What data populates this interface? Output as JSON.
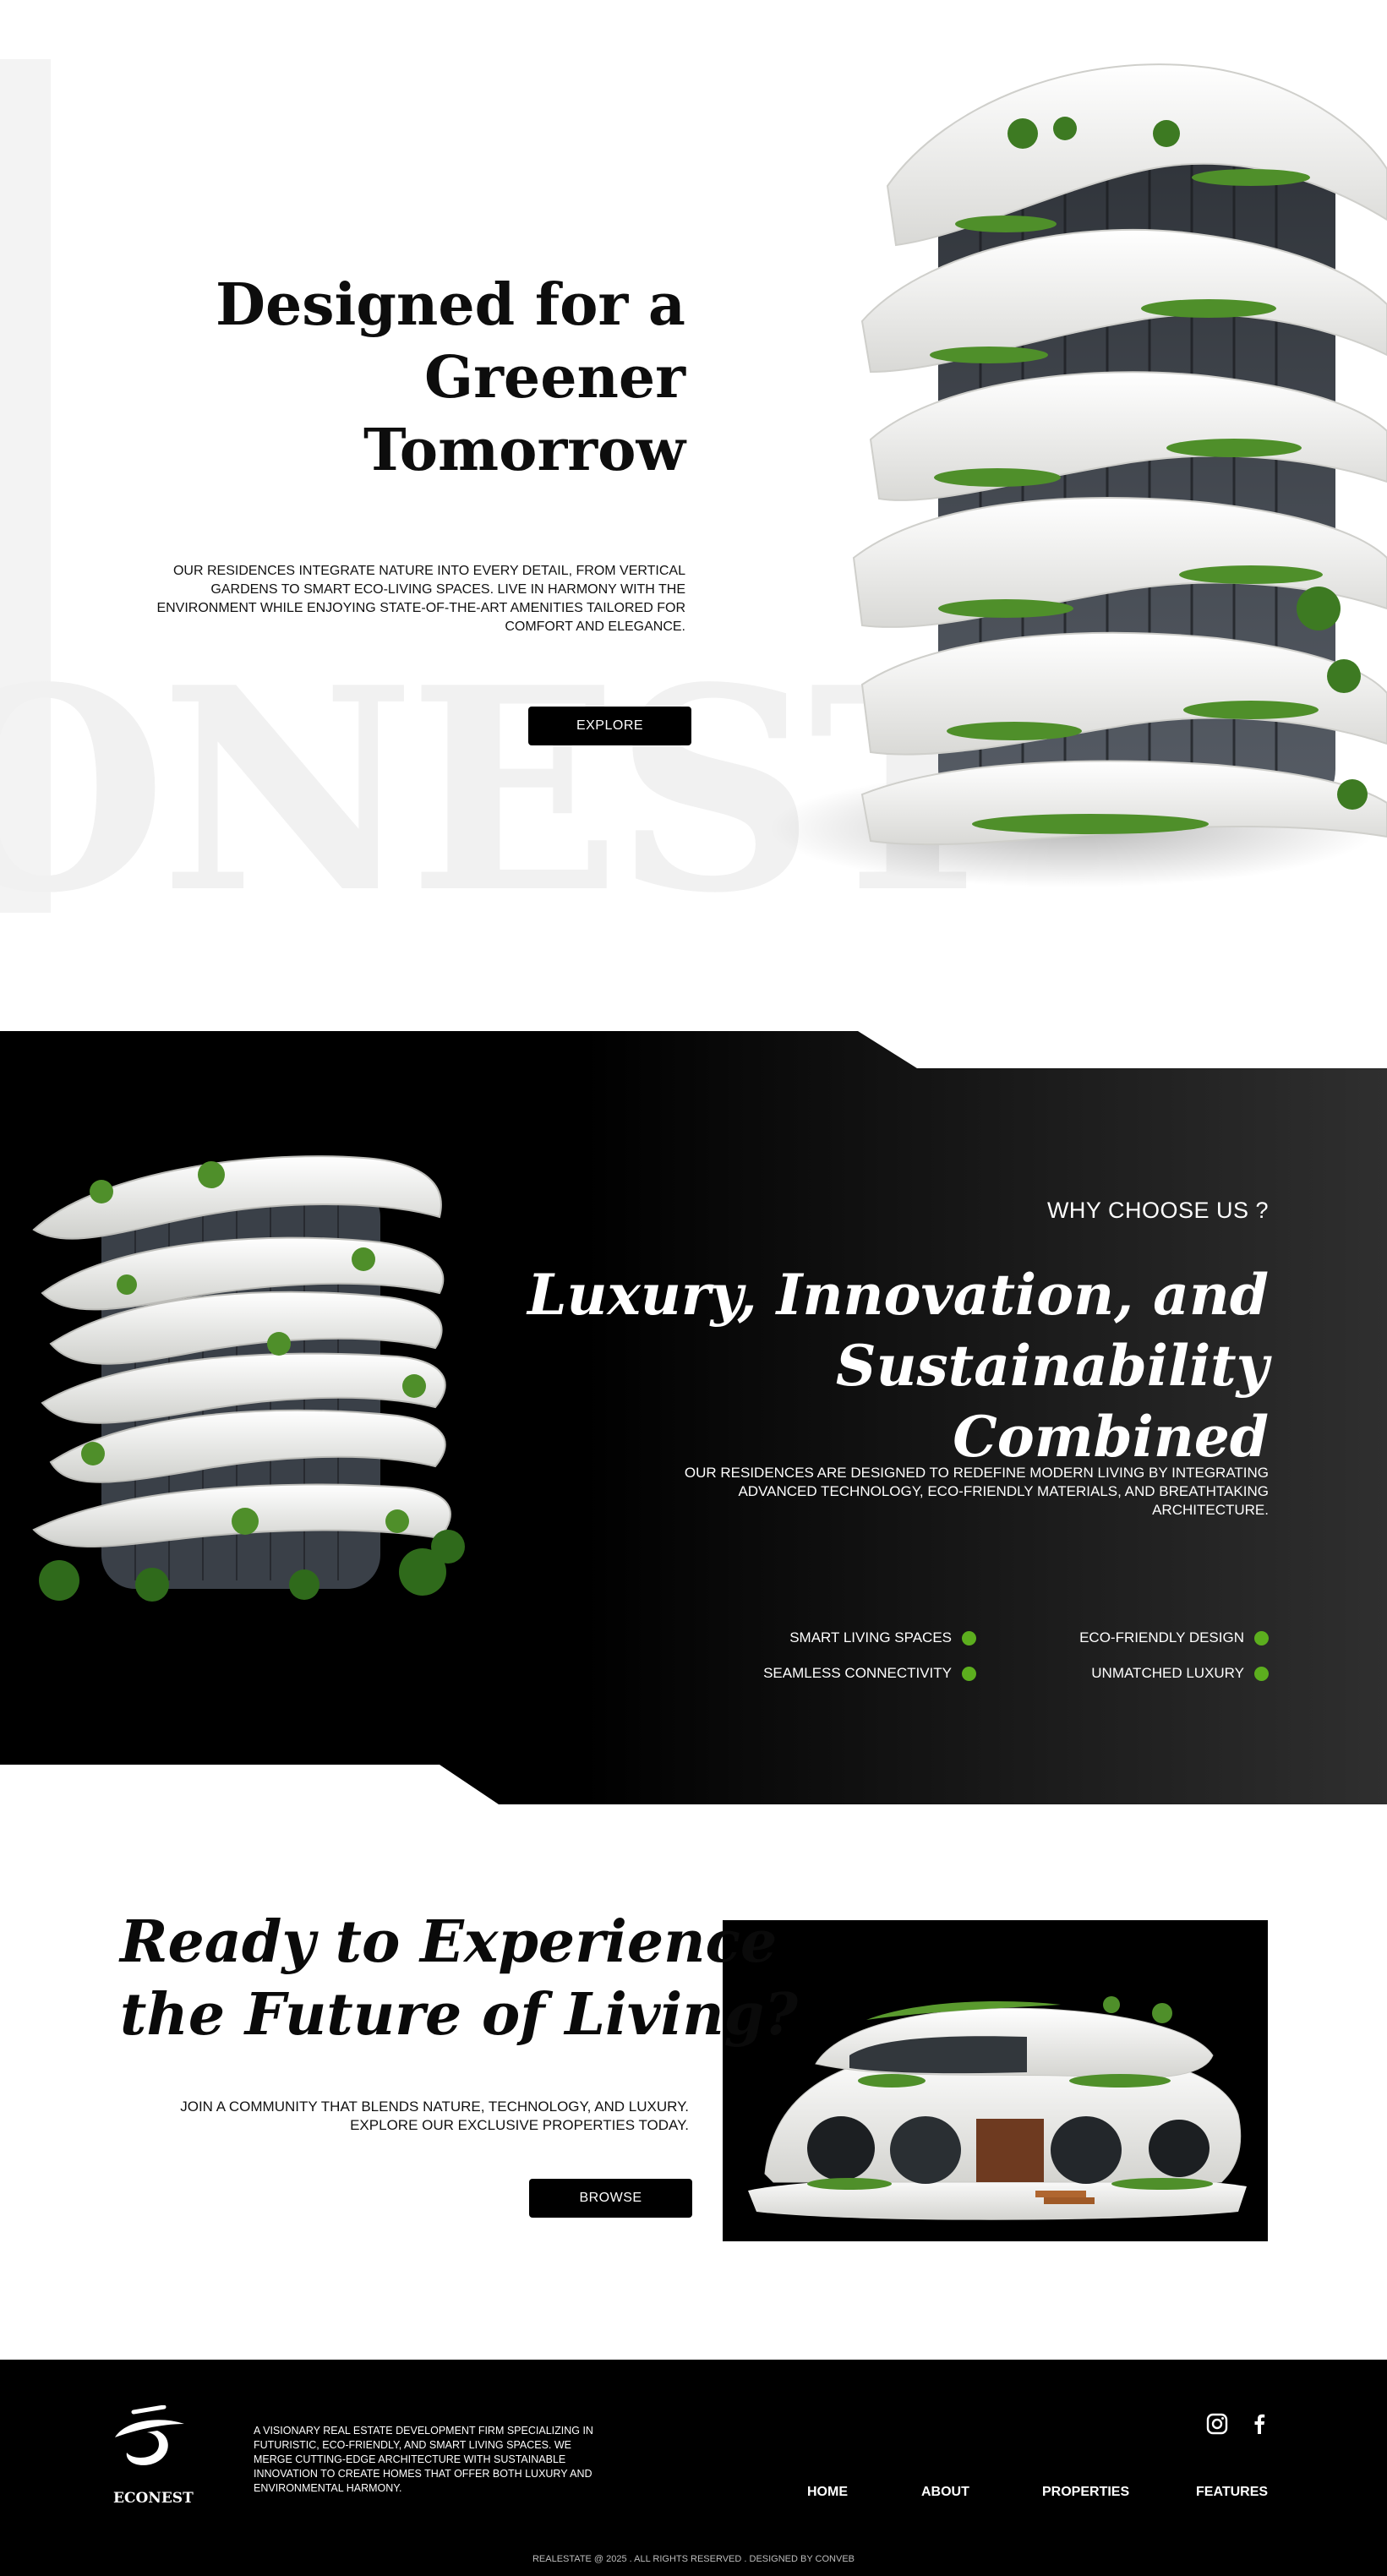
{
  "hero": {
    "watermark": "ONEST",
    "title_line1": "Designed  for  a",
    "title_line2": "Greener",
    "title_line3": "Tomorrow",
    "description": "OUR RESIDENCES INTEGRATE NATURE INTO EVERY DETAIL, FROM VERTICAL GARDENS TO SMART ECO-LIVING SPACES. LIVE IN HARMONY WITH THE ENVIRONMENT WHILE ENJOYING STATE-OF-THE-ART AMENITIES TAILORED FOR COMFORT AND ELEGANCE.",
    "button_label": "EXPLORE"
  },
  "why": {
    "kicker": "WHY CHOOSE US ?",
    "title_line1": "Luxury,  Innovation,  and",
    "title_line2": "Sustainability  Combined",
    "description": "OUR RESIDENCES ARE DESIGNED TO REDEFINE MODERN LIVING BY INTEGRATING ADVANCED TECHNOLOGY, ECO-FRIENDLY MATERIALS, AND BREATHTAKING ARCHITECTURE.",
    "features": [
      "SMART LIVING SPACES",
      "ECO-FRIENDLY DESIGN",
      "SEAMLESS CONNECTIVITY",
      "UNMATCHED LUXURY"
    ],
    "bullet_color": "#5cae1e"
  },
  "cta": {
    "title_line1": "Ready  to  Experience",
    "title_line2": "the  Future  of  Living?",
    "description_line1": "JOIN A COMMUNITY THAT BLENDS NATURE, TECHNOLOGY, AND LUXURY.",
    "description_line2": "EXPLORE OUR EXCLUSIVE PROPERTIES TODAY.",
    "button_label": "BROWSE"
  },
  "footer": {
    "logo_text": "ECONEST",
    "about": "A VISIONARY REAL ESTATE DEVELOPMENT FIRM SPECIALIZING IN FUTURISTIC, ECO-FRIENDLY, AND SMART LIVING SPACES. WE MERGE CUTTING-EDGE ARCHITECTURE WITH SUSTAINABLE INNOVATION TO CREATE HOMES THAT OFFER BOTH LUXURY AND ENVIRONMENTAL HARMONY.",
    "social_icons": [
      "instagram-icon",
      "facebook-icon"
    ],
    "nav": [
      "HOME",
      "ABOUT",
      "PROPERTIES",
      "FEATURES"
    ],
    "copyright": "REALESTATE @ 2025 . ALL RIGHTS RESERVED . DESIGNED BY CONVEB"
  }
}
